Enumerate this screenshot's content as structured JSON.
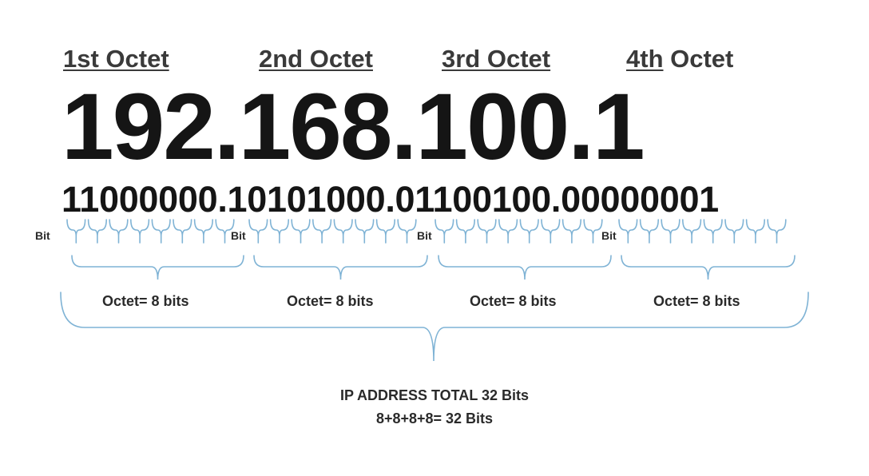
{
  "headings": {
    "octet1": "1st Octet",
    "octet2": "2nd Octet",
    "octet3": "3rd Octet",
    "octet4_ordinal": "4th",
    "octet4_word": "Octet"
  },
  "ip_decimal": "192.168.100.1",
  "ip_binary": "11000000.10101000.01100100.00000001",
  "bit_label": "Bit",
  "octet_label": "Octet= 8 bits",
  "total": {
    "line1": "IP ADDRESS TOTAL 32 Bits",
    "line2": "8+8+8+8= 32 Bits"
  },
  "colors": {
    "brace": "#7fb3d5",
    "text": "#1a1a1a"
  }
}
